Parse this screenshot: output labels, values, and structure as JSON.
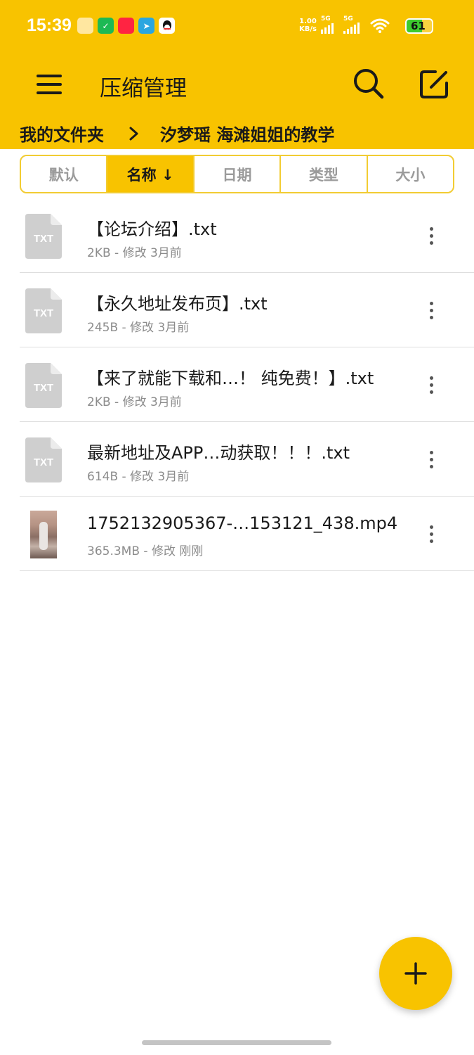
{
  "status_bar": {
    "time": "15:39",
    "network_speed_value": "1.00",
    "network_speed_unit": "KB/s",
    "sim1_label": "5G",
    "sim2_label": "5G",
    "battery_percent": "61",
    "battery_level": 0.61,
    "notification_icons": [
      "notes-icon",
      "checklist-icon",
      "redbook-icon",
      "telegram-icon",
      "qq-icon"
    ]
  },
  "app_bar": {
    "title": "压缩管理",
    "search_icon": "search-icon",
    "edit_icon": "edit-icon"
  },
  "breadcrumb": {
    "root": "我的文件夹",
    "current": "汐梦瑶 海滩姐姐的教学"
  },
  "sort_tabs": [
    {
      "label": "默认",
      "active": false
    },
    {
      "label": "名称 ↓",
      "active": true
    },
    {
      "label": "日期",
      "active": false
    },
    {
      "label": "类型",
      "active": false
    },
    {
      "label": "大小",
      "active": false
    }
  ],
  "files": [
    {
      "name": "【论坛介绍】.txt",
      "meta": "2KB - 修改 3月前",
      "type": "txt",
      "icon_label": "TXT"
    },
    {
      "name": "【永久地址发布页】.txt",
      "meta": "245B - 修改 3月前",
      "type": "txt",
      "icon_label": "TXT"
    },
    {
      "name": "【来了就能下载和…！ 纯免费！】.txt",
      "meta": "2KB - 修改 3月前",
      "type": "txt",
      "icon_label": "TXT"
    },
    {
      "name": "最新地址及APP…动获取！！！.txt",
      "meta": "614B - 修改 3月前",
      "type": "txt",
      "icon_label": "TXT"
    },
    {
      "name": "1752132905367-…153121_438.mp4",
      "meta": "365.3MB - 修改 刚刚",
      "type": "video",
      "icon_label": ""
    }
  ],
  "fab": {
    "icon": "plus-icon"
  },
  "colors": {
    "primary": "#F8C300",
    "tab_border": "#F2CC33",
    "text_primary": "#1a1a1a",
    "text_secondary": "#8c8c8c",
    "file_icon": "#c9c9c9"
  }
}
